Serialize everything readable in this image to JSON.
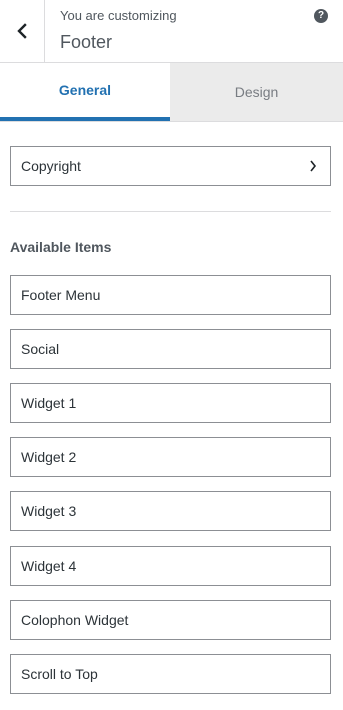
{
  "header": {
    "back_icon": "chevron-left-icon",
    "customizing_label": "You are customizing",
    "section_title": "Footer",
    "help_icon": "question-circle-icon",
    "help_glyph": "?"
  },
  "tabs": [
    {
      "label": "General",
      "active": true
    },
    {
      "label": "Design",
      "active": false
    }
  ],
  "copyright": {
    "label": "Copyright",
    "icon": "chevron-right-icon"
  },
  "available_items": {
    "heading": "Available Items",
    "items": [
      {
        "label": "Footer Menu"
      },
      {
        "label": "Social"
      },
      {
        "label": "Widget 1"
      },
      {
        "label": "Widget 2"
      },
      {
        "label": "Widget 3"
      },
      {
        "label": "Widget 4"
      },
      {
        "label": "Colophon Widget"
      },
      {
        "label": "Scroll to Top"
      }
    ]
  },
  "colors": {
    "accent": "#2271b1",
    "inactive_tab_bg": "#ebebeb",
    "border": "#8c8f94",
    "divider": "#dcdcde"
  }
}
